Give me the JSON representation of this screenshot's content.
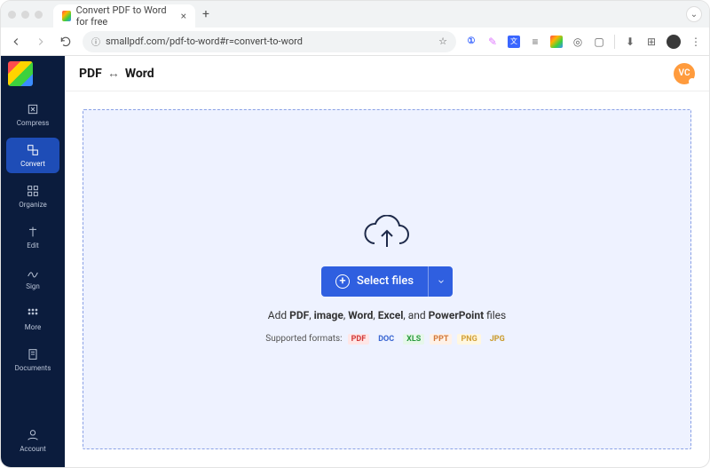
{
  "browser": {
    "tab_title": "Convert PDF to Word for free",
    "url": "smallpdf.com/pdf-to-word#r=convert-to-word"
  },
  "header": {
    "title_left": "PDF",
    "title_right": "Word",
    "avatar_initials": "VC"
  },
  "sidebar": {
    "items": [
      {
        "label": "Compress"
      },
      {
        "label": "Convert"
      },
      {
        "label": "Organize"
      },
      {
        "label": "Edit"
      },
      {
        "label": "Sign"
      },
      {
        "label": "More"
      },
      {
        "label": "Documents"
      }
    ],
    "account_label": "Account"
  },
  "dropzone": {
    "button_label": "Select files",
    "hint_prefix": "Add ",
    "hint_b1": "PDF",
    "hint_s1": ", ",
    "hint_b2": "image",
    "hint_s2": ", ",
    "hint_b3": "Word",
    "hint_s3": ", ",
    "hint_b4": "Excel",
    "hint_s4": ", and ",
    "hint_b5": "PowerPoint",
    "hint_suffix": " files",
    "supported_label": "Supported formats:",
    "formats": {
      "pdf": "PDF",
      "doc": "DOC",
      "xls": "XLS",
      "ppt": "PPT",
      "png": "PNG",
      "jpg": "JPG"
    }
  }
}
